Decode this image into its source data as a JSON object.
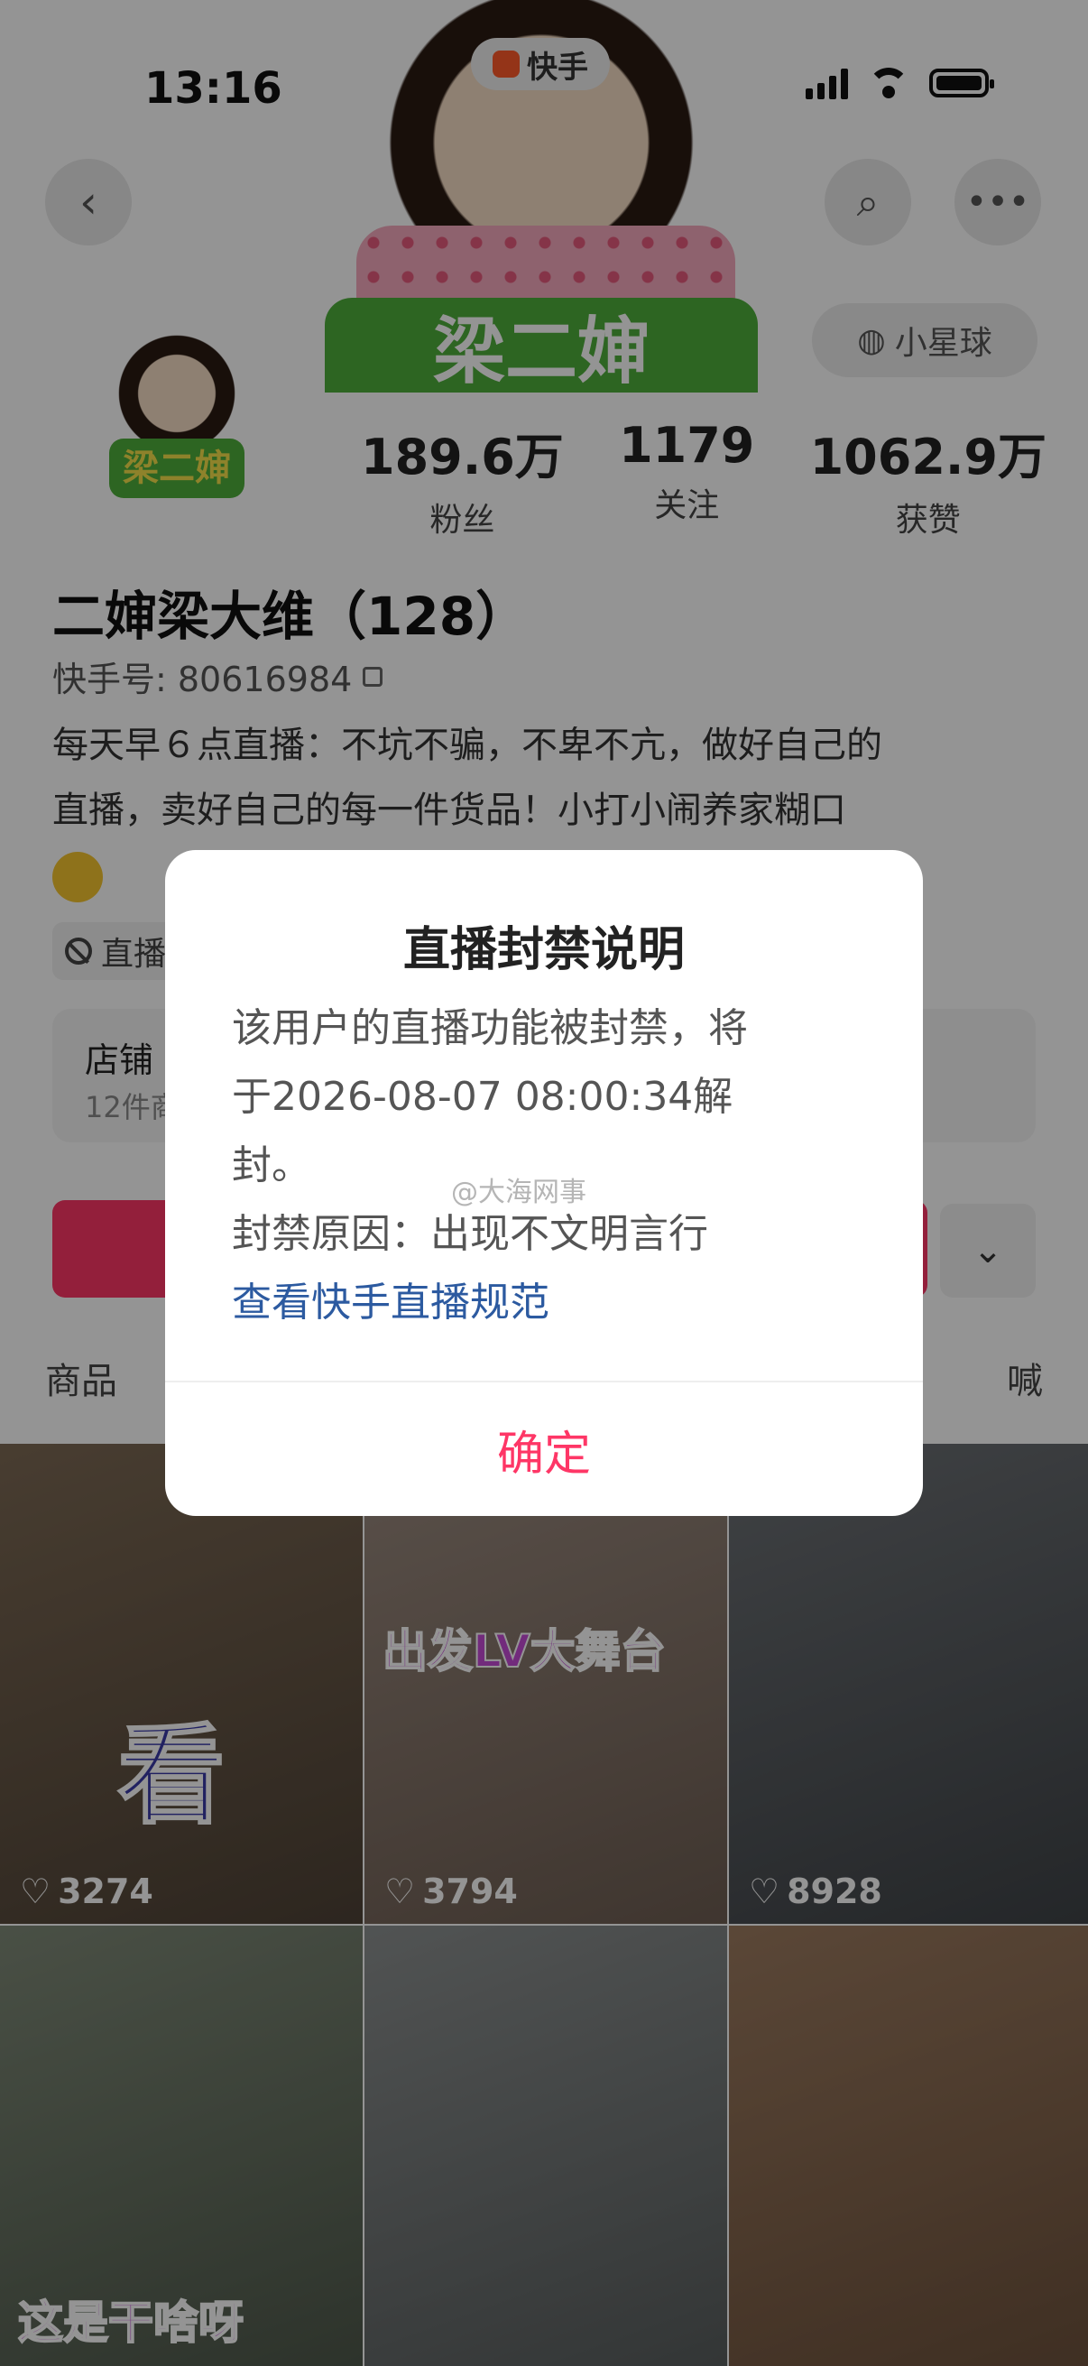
{
  "status_bar": {
    "time": "13:16"
  },
  "app_badge": {
    "label": "快手"
  },
  "header": {
    "planet_label": "小星球",
    "avatar_logo": "梁二婶"
  },
  "profile": {
    "name": "二婶梁大维（128）",
    "uid": "快手号: 80616984",
    "bio_line1": "每天早６点直播：不坑不骗，不卑不亢，做好自己的",
    "bio_line2": "直播，卖好自己的每一件货品！小打小闹养家糊口",
    "tag": "直播",
    "stats": [
      {
        "num": "189.6万",
        "label": "粉丝"
      },
      {
        "num": "1179",
        "label": "关注"
      },
      {
        "num": "1062.9万",
        "label": "获赞"
      }
    ]
  },
  "shop": {
    "title": "店铺",
    "subtitle": "12件商"
  },
  "tabs": {
    "products": "商品",
    "right": "喊"
  },
  "grid": [
    {
      "caption": "看",
      "likes": "3274",
      "bg": "#6b5a48"
    },
    {
      "caption": "出发LV大舞台",
      "likes": "3794",
      "bg": "#8c7a6e"
    },
    {
      "caption": "",
      "likes": "8928",
      "bg": "#5b5f63"
    },
    {
      "caption": "这是干啥呀",
      "likes": "",
      "bg": "#6f7a6a"
    },
    {
      "caption": "",
      "likes": "",
      "bg": "#7a7f80"
    },
    {
      "caption": "",
      "likes": "",
      "bg": "#8a6a52"
    }
  ],
  "dialog": {
    "title": "直播封禁说明",
    "line1": "该用户的直播功能被封禁，将",
    "line2": "于2026-08-07 08:00:34解",
    "line3": "封。",
    "reason": "封禁原因：出现不文明言行",
    "link": "查看快手直播规范",
    "confirm": "确定"
  },
  "watermark": "@大海网事"
}
